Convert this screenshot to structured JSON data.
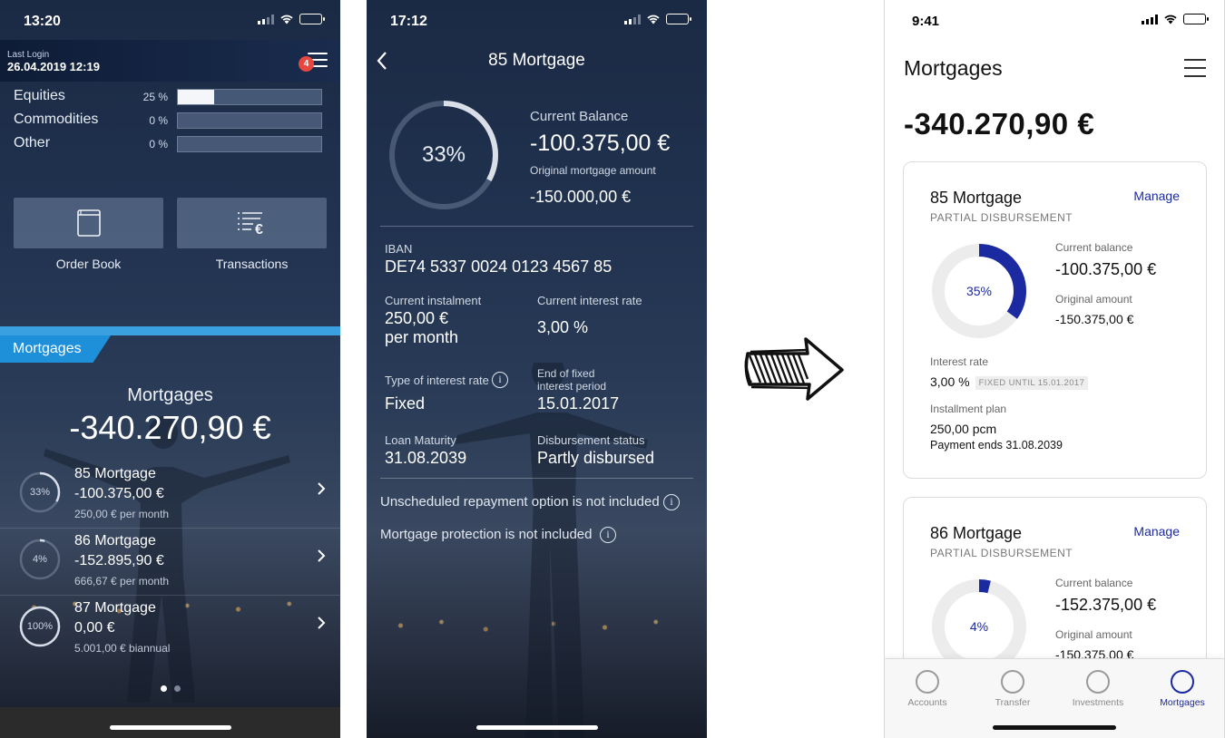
{
  "phone1": {
    "time": "13:20",
    "last_login_label": "Last Login",
    "last_login_date": "26.04.2019 12:19",
    "notification_count": "4",
    "allocations": [
      {
        "name": "Equities",
        "percent": "25 %",
        "fraction": 0.25
      },
      {
        "name": "Commodities",
        "percent": "0 %",
        "fraction": 0
      },
      {
        "name": "Other",
        "percent": "0 %",
        "fraction": 0
      }
    ],
    "tiles": [
      {
        "label": "Order Book",
        "icon": "book-icon"
      },
      {
        "label": "Transactions",
        "icon": "transactions-list-euro-icon"
      }
    ],
    "section_tab": "Mortgages",
    "section_title": "Mortgages",
    "section_total": "-340.270,90 €",
    "mortgages": [
      {
        "name": "85 Mortgage",
        "amount": "-100.375,00 €",
        "sub": "250,00 € per month",
        "percent_label": "33%",
        "progress": 0.33
      },
      {
        "name": "86 Mortgage",
        "amount": "-152.895,90 €",
        "sub": "666,67 € per month",
        "percent_label": "4%",
        "progress": 0.04
      },
      {
        "name": "87 Mortgage",
        "amount": "0,00 €",
        "sub": "5.001,00 € biannual",
        "percent_label": "100%",
        "progress": 1.0
      }
    ],
    "page_count": 2,
    "active_page": 0
  },
  "phone2": {
    "time": "17:12",
    "title": "85 Mortgage",
    "progress_label": "33%",
    "progress": 0.33,
    "current_balance_label": "Current Balance",
    "current_balance": "-100.375,00 €",
    "original_amount_label": "Original mortgage amount",
    "original_amount": "-150.000,00 €",
    "iban_label": "IBAN",
    "iban": "DE74 5337 0024 0123 4567 85",
    "instalment_label": "Current instalment",
    "instalment_value": "250,00 €",
    "instalment_period": "per month",
    "interest_rate_label": "Current interest rate",
    "interest_rate": "3,00 %",
    "rate_type_label": "Type of interest rate",
    "rate_type": "Fixed",
    "fixed_end_label_1": "End of fixed",
    "fixed_end_label_2": "interest period",
    "fixed_end": "15.01.2017",
    "maturity_label": "Loan Maturity",
    "maturity": "31.08.2039",
    "disbursement_label": "Disbursement status",
    "disbursement": "Partly disbursed",
    "notice_1": "Unscheduled repayment option is not included",
    "notice_2": "Mortgage protection is not included",
    "info_glyph": "i"
  },
  "phone3": {
    "time": "9:41",
    "title": "Mortgages",
    "total": "-340.270,90 €",
    "cards": [
      {
        "name": "85 Mortgage",
        "status": "PARTIAL DISBURSEMENT",
        "manage": "Manage",
        "percent_label": "35%",
        "progress": 0.35,
        "balance_label": "Current balance",
        "balance": "-100.375,00 €",
        "original_label": "Original amount",
        "original": "-150.375,00 €",
        "interest_label": "Interest rate",
        "interest": "3,00 %",
        "fixed_tag": "FIXED UNTIL 15.01.2017",
        "plan_label": "Installment plan",
        "plan": "250,00 pcm",
        "plan_end": "Payment ends 31.08.2039"
      },
      {
        "name": "86 Mortgage",
        "status": "PARTIAL DISBURSEMENT",
        "manage": "Manage",
        "percent_label": "4%",
        "progress": 0.04,
        "balance_label": "Current balance",
        "balance": "-152.375,00 €",
        "original_label": "Original amount",
        "original": "-150.375,00 €"
      }
    ],
    "tabs": [
      {
        "label": "Accounts",
        "active": false
      },
      {
        "label": "Transfer",
        "active": false
      },
      {
        "label": "Investments",
        "active": false
      },
      {
        "label": "Mortgages",
        "active": true
      }
    ],
    "accent_color": "#1b2aa0"
  }
}
